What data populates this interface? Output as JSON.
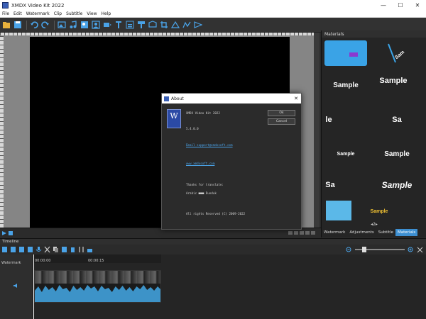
{
  "window": {
    "title": "XMDX Video Kit 2022",
    "minimize": "—",
    "maximize": "☐",
    "close": "✕"
  },
  "menu": [
    "File",
    "Edit",
    "Watermark",
    "Clip",
    "Subtitle",
    "View",
    "Help"
  ],
  "colors": {
    "accent": "#3d8fd1",
    "toolbar_icon": "#4aa3e8",
    "dialog_bg": "#2b2b2b",
    "link": "#4aa3e8",
    "waveform": "#3d93c8"
  },
  "materials": {
    "header": "Materials",
    "items": [
      "",
      "",
      "Sample",
      "Sample",
      "le",
      "Sa",
      "Sample",
      "Sample",
      "Sa",
      "Sample",
      "",
      "Sample"
    ],
    "pager": "2",
    "tabs": [
      "Watermark",
      "Adjustments",
      "Subtitle",
      "Materials"
    ],
    "active_tab": "Materials"
  },
  "timeline": {
    "header": "Timeline",
    "track_label": "Watermark",
    "ruler_ticks": [
      "00:00:00",
      "00:00:15"
    ]
  },
  "about": {
    "title": "About",
    "close": "✕",
    "logo_letter": "W",
    "product": "XMDX Video Kit 2022",
    "version": "5.4.0.0",
    "email": "Email support@xmdxsoft.com",
    "website": "www.xmdxsoft.com",
    "thanks": "Thanks for translate:",
    "translator": "Arabic ■■■ Dueduk",
    "copyright": "All rights Reserved (C) 2009-2022",
    "ok_label": "Ok",
    "cancel_label": "Cancel"
  }
}
